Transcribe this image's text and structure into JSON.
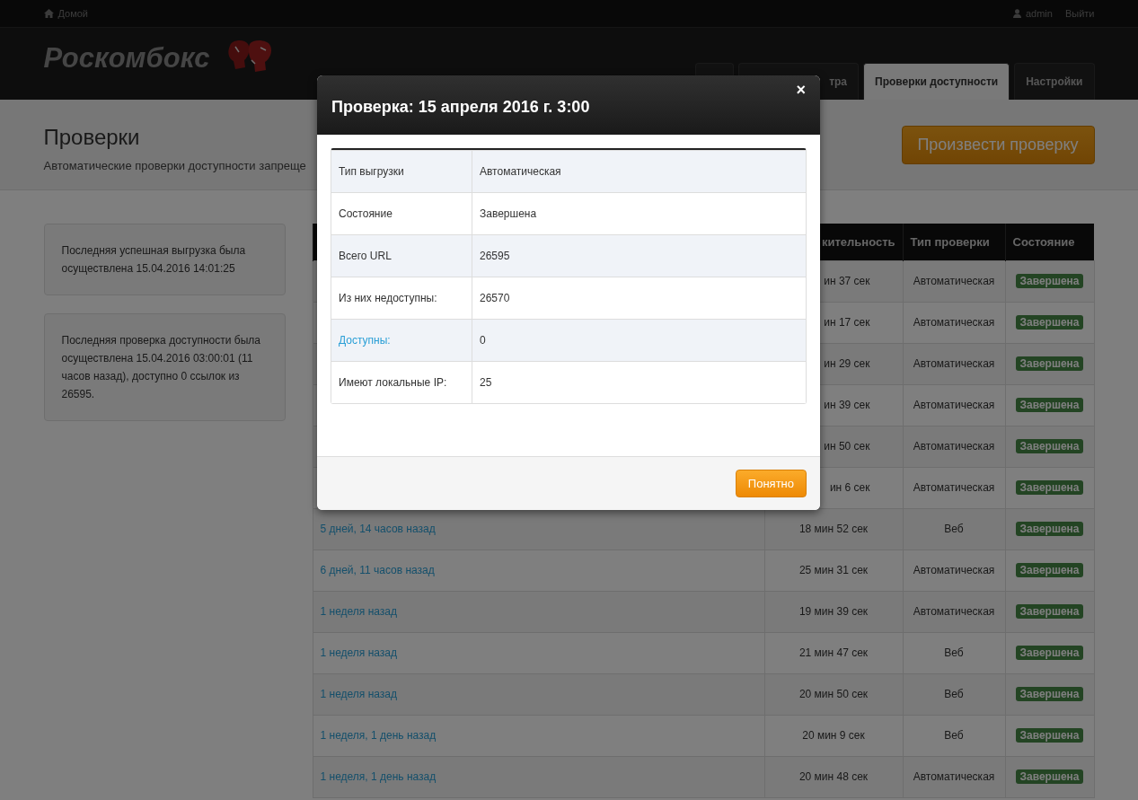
{
  "topbar": {
    "home": "Домой",
    "user": "admin",
    "logout": "Выйти"
  },
  "brand": {
    "name": "Роскомбокс"
  },
  "tabs": [
    {
      "selected": false
    },
    {
      "label": "тра",
      "selected": false
    },
    {
      "label": "Проверки доступности",
      "selected": true
    },
    {
      "label": "Настройки",
      "selected": false
    }
  ],
  "page": {
    "title": "Проверки",
    "subtitle": "Автоматические проверки доступности запреще",
    "action": "Произвести проверку"
  },
  "info_cards": [
    "Последняя успешная выгрузка была осуществлена 15.04.2016 14:01:25",
    "Последняя проверка доступности была осуществлена 15.04.2016 03:00:01 (11 часов назад), доступно 0 ссылок из 26595."
  ],
  "table": {
    "columns": [
      "кительность",
      "Тип проверки",
      "Состояние"
    ],
    "rows": [
      {
        "duration": "ин 37 сек",
        "type": "Автоматическая",
        "status": "Завершена"
      },
      {
        "duration": "ин 17 сек",
        "type": "Автоматическая",
        "status": "Завершена"
      },
      {
        "duration": "ин 29 сек",
        "type": "Автоматическая",
        "status": "Завершена"
      },
      {
        "duration": "ин 39 сек",
        "type": "Автоматическая",
        "status": "Завершена"
      },
      {
        "duration": "ин 50 сек",
        "type": "Автоматическая",
        "status": "Завершена"
      },
      {
        "duration": "ин 6 сек",
        "type": "Автоматическая",
        "status": "Завершена"
      },
      {
        "when": "5 дней, 14 часов назад",
        "duration": "18 мин 52 сек",
        "type": "Веб",
        "status": "Завершена"
      },
      {
        "when": "6 дней, 11 часов назад",
        "duration": "25 мин 31 сек",
        "type": "Автоматическая",
        "status": "Завершена"
      },
      {
        "when": "1 неделя назад",
        "duration": "19 мин 39 сек",
        "type": "Автоматическая",
        "status": "Завершена"
      },
      {
        "when": "1 неделя назад",
        "duration": "21 мин 47 сек",
        "type": "Веб",
        "status": "Завершена"
      },
      {
        "when": "1 неделя назад",
        "duration": "20 мин 50 сек",
        "type": "Веб",
        "status": "Завершена"
      },
      {
        "when": "1 неделя, 1 день назад",
        "duration": "20 мин 9 сек",
        "type": "Веб",
        "status": "Завершена"
      },
      {
        "when": "1 неделя, 1 день назад",
        "duration": "20 мин 48 сек",
        "type": "Автоматическая",
        "status": "Завершена"
      }
    ]
  },
  "modal": {
    "title": "Проверка: 15 апреля 2016 г. 3:00",
    "close": "×",
    "rows": [
      {
        "label": "Тип выгрузки",
        "value": "Автоматическая",
        "kind": "text"
      },
      {
        "label": "Состояние",
        "value": "Завершена",
        "kind": "text"
      },
      {
        "label": "Всего URL",
        "value": "26595",
        "kind": "text"
      },
      {
        "label": "Из них недоступны:",
        "value": "26570",
        "kind": "text"
      },
      {
        "label": "Доступны:",
        "value": "0",
        "kind": "link"
      },
      {
        "label": "Имеют локальные IP:",
        "value": "25",
        "kind": "text"
      }
    ],
    "button": "Понятно"
  }
}
